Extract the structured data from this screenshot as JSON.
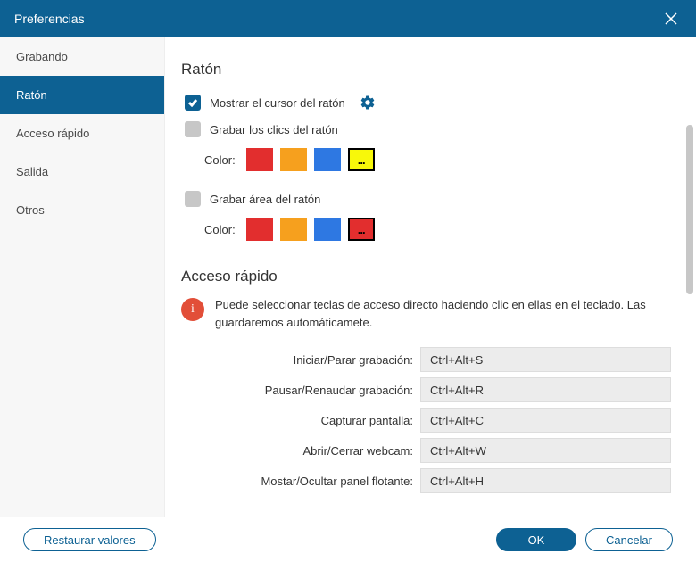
{
  "window": {
    "title": "Preferencias"
  },
  "sidebar": {
    "items": [
      {
        "label": "Grabando",
        "active": false
      },
      {
        "label": "Ratón",
        "active": true
      },
      {
        "label": "Acceso rápido",
        "active": false
      },
      {
        "label": "Salida",
        "active": false
      },
      {
        "label": "Otros",
        "active": false
      }
    ]
  },
  "mouse": {
    "heading": "Ratón",
    "show_cursor": {
      "label": "Mostrar el cursor del ratón",
      "checked": true
    },
    "record_clicks": {
      "label": "Grabar los clics del ratón",
      "checked": false
    },
    "record_area": {
      "label": "Grabar área del ratón",
      "checked": false
    },
    "color_label": "Color:",
    "clicks_colors": [
      "#E22E2E",
      "#F6A01E",
      "#2E78E2",
      "#F8F80A"
    ],
    "area_colors": [
      "#E22E2E",
      "#F6A01E",
      "#2E78E2",
      "#E22E2E"
    ],
    "more_label": "..."
  },
  "shortcuts": {
    "heading": "Acceso rápido",
    "info": "Puede seleccionar teclas de acceso directo haciendo clic en ellas en el teclado. Las guardaremos automáticamete.",
    "items": [
      {
        "label": "Iniciar/Parar grabación:",
        "value": "Ctrl+Alt+S"
      },
      {
        "label": "Pausar/Renaudar grabación:",
        "value": "Ctrl+Alt+R"
      },
      {
        "label": "Capturar pantalla:",
        "value": "Ctrl+Alt+C"
      },
      {
        "label": "Abrir/Cerrar webcam:",
        "value": "Ctrl+Alt+W"
      },
      {
        "label": "Mostar/Ocultar panel flotante:",
        "value": "Ctrl+Alt+H"
      }
    ]
  },
  "footer": {
    "restore": "Restaurar valores",
    "ok": "OK",
    "cancel": "Cancelar"
  }
}
